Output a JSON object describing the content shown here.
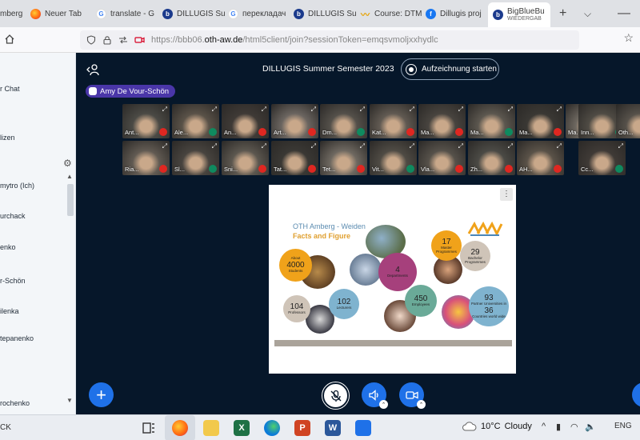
{
  "browser": {
    "tabs": [
      {
        "label": "mberg",
        "icon": "none"
      },
      {
        "label": "Neuer Tab",
        "icon": "firefox-icon"
      },
      {
        "label": "translate - G",
        "icon": "google-icon"
      },
      {
        "label": "DILLUGIS Su",
        "icon": "bigbluebutton-icon"
      },
      {
        "label": "перекладач",
        "icon": "google-icon"
      },
      {
        "label": "DILLUGIS Su",
        "icon": "bigbluebutton-icon"
      },
      {
        "label": "Course: DTM",
        "icon": "moodle-icon"
      },
      {
        "label": "Dillugis proj",
        "icon": "facebook-icon"
      }
    ],
    "active_tab": {
      "line1": "BigBlueBu",
      "line2": "WIEDERGAB"
    },
    "new_tab": "+",
    "tab_list": "⌵",
    "url_prefix": "https://bbb06.",
    "url_domain": "oth-aw.de",
    "url_suffix": "/html5client/join?sessionToken=emqsvmoljxxhydlc"
  },
  "sidebar": {
    "items": [
      "r Chat",
      "lizen",
      "mytro (Ich)",
      "urchack",
      "enko",
      "r-Schön",
      "ilenka",
      "tepanenko",
      "rochenko"
    ]
  },
  "meeting": {
    "title": "DILLUGIS Summer Semester 2023",
    "record_label": "Aufzeichnung starten",
    "talking": "Amy De Vour-Schön"
  },
  "webcams": {
    "row1": [
      "Ant...",
      "Ale...",
      "An...",
      "Art...",
      "Dm...",
      "Kat...",
      "Ma...",
      "Ma...",
      "Ma...",
      "Ma...",
      "Inn...",
      "Oth..."
    ],
    "row2": [
      "Ria...",
      "Sl...",
      "Sni...",
      "Tat...",
      "Tet...",
      "Vit...",
      "Vla...",
      "Zh...",
      "AH...",
      "Cc..."
    ]
  },
  "presentation": {
    "menu_label": "⋮",
    "slide_title": "OTH Amberg - Weiden",
    "slide_subtitle": "Facts and Figure",
    "stats": {
      "students": {
        "num": "4000",
        "pre": "About",
        "label": "Students"
      },
      "departments": {
        "num": "4",
        "label": "Departments"
      },
      "master": {
        "num": "17",
        "label": "Master Programmes"
      },
      "bachelor": {
        "num": "29",
        "label": "Bachelor Programmes"
      },
      "professors": {
        "num": "104",
        "label": "Professors"
      },
      "lecturers": {
        "num": "102",
        "label": "Lecturers"
      },
      "employees": {
        "num": "450",
        "label": "Employees"
      },
      "partners": {
        "num1": "93",
        "label1": "Partner Universities in",
        "num2": "36",
        "label2": "Countries world wide"
      }
    }
  },
  "controls": {
    "plus": "+"
  },
  "taskbar": {
    "search_fragment": "CK",
    "weather_temp": "10°C",
    "weather_desc": "Cloudy",
    "language": "ENG"
  },
  "colors": {
    "meeting_bg": "#06172a",
    "accent_blue": "#1f71e8",
    "talker_purple": "#4a36a8",
    "mic_muted": "#df2721",
    "listen_only": "#0f8a5f",
    "bubble_orange": "#f0a21a",
    "bubble_purple": "#a6407c",
    "bubble_teal": "#6aaa98",
    "bubble_blue": "#7fb3cf",
    "bubble_grey": "#cfc4b8"
  }
}
